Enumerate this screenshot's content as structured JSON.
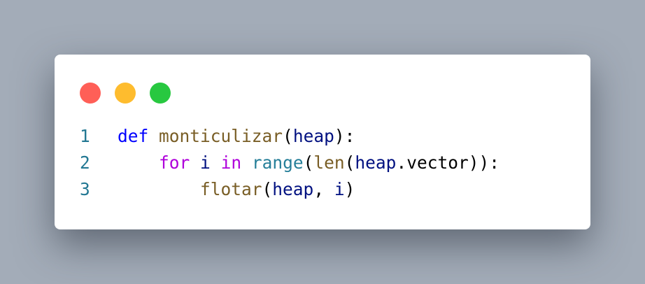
{
  "window": {
    "controls": [
      {
        "name": "close",
        "color": "#ff5f57"
      },
      {
        "name": "minimize",
        "color": "#febc2e"
      },
      {
        "name": "maximize",
        "color": "#28c840"
      }
    ]
  },
  "code": {
    "language": "python",
    "lines": [
      {
        "number": "1",
        "indent": "",
        "tokens": [
          "def",
          " ",
          "monticulizar",
          "(",
          "heap",
          "):"
        ]
      },
      {
        "number": "2",
        "indent": "    ",
        "tokens": [
          "for",
          " ",
          "i",
          " ",
          "in",
          " ",
          "range",
          "(",
          "len",
          "(",
          "heap",
          ".vector",
          "))",
          ":"
        ]
      },
      {
        "number": "3",
        "indent": "        ",
        "tokens": [
          "flotar",
          "(",
          "heap",
          ", ",
          "i",
          ")"
        ]
      }
    ]
  },
  "colors": {
    "background": "#a3acb8",
    "card": "#ffffff",
    "line_number": "#237893",
    "keyword": "#0000ff",
    "control_keyword": "#af00db",
    "function": "#795e26",
    "variable": "#001080",
    "builtin": "#267f99",
    "punctuation": "#000000"
  }
}
